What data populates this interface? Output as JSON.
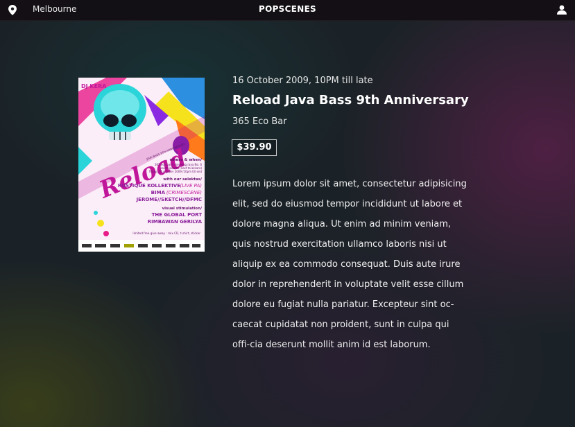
{
  "header": {
    "location": "Melbourne",
    "brand": "POPSCENES",
    "location_icon": "map-pin-icon",
    "user_icon": "user-icon"
  },
  "poster": {
    "label": "DJ KERA",
    "logo": "Reload",
    "tagline": "JAVA BASS 9TH ANNIVERSARY",
    "where_when": "where & when/",
    "where_line1": "365 eco bar Jl. kemang raya No. 6",
    "where_line2": "south jakarta (next to aksara)",
    "where_line3": "friday, 16 october 2009 /10pm till end",
    "selektas_heading": "with our selektas/",
    "selekta1": "RUSTIQUE KOLLEKTIVE",
    "selekta1_note": "(LIVE PA)",
    "selekta2": "BIMA",
    "selekta2_note": "(CRIMESCENE)",
    "selekta3": "JEROME//SKETCH//DFMC",
    "visual_heading": "visual stimulation/",
    "visual1": "THE GLOBAL PORT",
    "visual2": "RIMBAWAN GERILYA",
    "giveaway": "limited free give away : mix CD, t-shirt, sticker"
  },
  "event": {
    "date": "16 October 2009, 10PM till late",
    "title": "Reload Java Bass 9th Anniversary",
    "venue": "365 Eco Bar",
    "price": "$39.90",
    "description": "Lorem ipsum dolor sit amet, consectetur adipisicing elit, sed do eiusmod tempor incididunt ut labore et dolore magna aliqua. Ut enim ad minim veniam, quis nostrud exercitation ullamco laboris nisi ut aliquip ex ea commodo consequat. Duis aute irure dolor in reprehenderit in voluptate velit esse cillum dolore eu fugiat nulla pariatur. Excepteur sint oc-caecat cupidatat non proident, sunt in culpa qui offi-cia deserunt mollit anim id est laborum."
  },
  "colors": {
    "poster_magenta": "#c0179a",
    "poster_cyan": "#2ad4d8",
    "poster_yellow": "#f5e21c"
  }
}
